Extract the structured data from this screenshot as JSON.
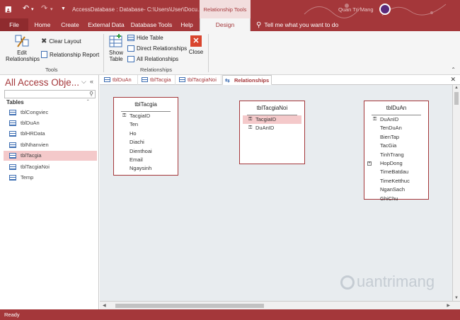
{
  "titlebar": {
    "document_title": "AccessDatabase : Database- C:\\Users\\User\\Docu...",
    "context_tab": "Relationship Tools",
    "user_name": "Quan Tri Mang"
  },
  "tabs": [
    "File",
    "Home",
    "Create",
    "External Data",
    "Database Tools",
    "Help",
    "Design"
  ],
  "tell_me": "Tell me what you want to do",
  "ribbon": {
    "tools_group": "Tools",
    "relationships_group": "Relationships",
    "edit_relationships_1": "Edit",
    "edit_relationships_2": "Relationships",
    "clear_layout": "Clear Layout",
    "relationship_report": "Relationship Report",
    "show_table_1": "Show",
    "show_table_2": "Table",
    "hide_table": "Hide Table",
    "direct_relationships": "Direct Relationships",
    "all_relationships": "All Relationships",
    "close": "Close"
  },
  "nav": {
    "title": "All Access Obje...",
    "section": "Tables",
    "items": [
      "tblCongviec",
      "tblDuAn",
      "tblHRData",
      "tblNhanvien",
      "tblTacgia",
      "tblTacgiaNoi",
      "Temp"
    ],
    "selected_index": 4
  },
  "doc_tabs": [
    "tblDuAn",
    "tblTacgia",
    "tblTacgiaNoi",
    "Relationships"
  ],
  "tables": [
    {
      "name": "tblTacgia",
      "fields": [
        "TacgiaID",
        "Ten",
        "Ho",
        "Diachi",
        "Dienthoai",
        "Email",
        "Ngaysinh"
      ]
    },
    {
      "name": "tblTacgiaNoi",
      "fields": [
        "TacgiaID",
        "DuAnID"
      ]
    },
    {
      "name": "tblDuAn",
      "fields": [
        "DuAnID",
        "TenDuAn",
        "BienTap",
        "TacGia",
        "TinhTrang",
        "HopDong",
        "TimeBatdau",
        "TimeKetthuc",
        "NganSach",
        "GhiChu"
      ]
    }
  ],
  "watermark": "uantrimang",
  "status": "Ready",
  "icons": [
    "save-icon",
    "undo-icon",
    "redo-icon",
    "lightbulb-icon",
    "key-icon",
    "table-icon",
    "search-icon",
    "close-icon"
  ],
  "colors": {
    "accent": "#a4373a",
    "selection": "#f4c9ca",
    "canvas": "#e8ecef"
  }
}
